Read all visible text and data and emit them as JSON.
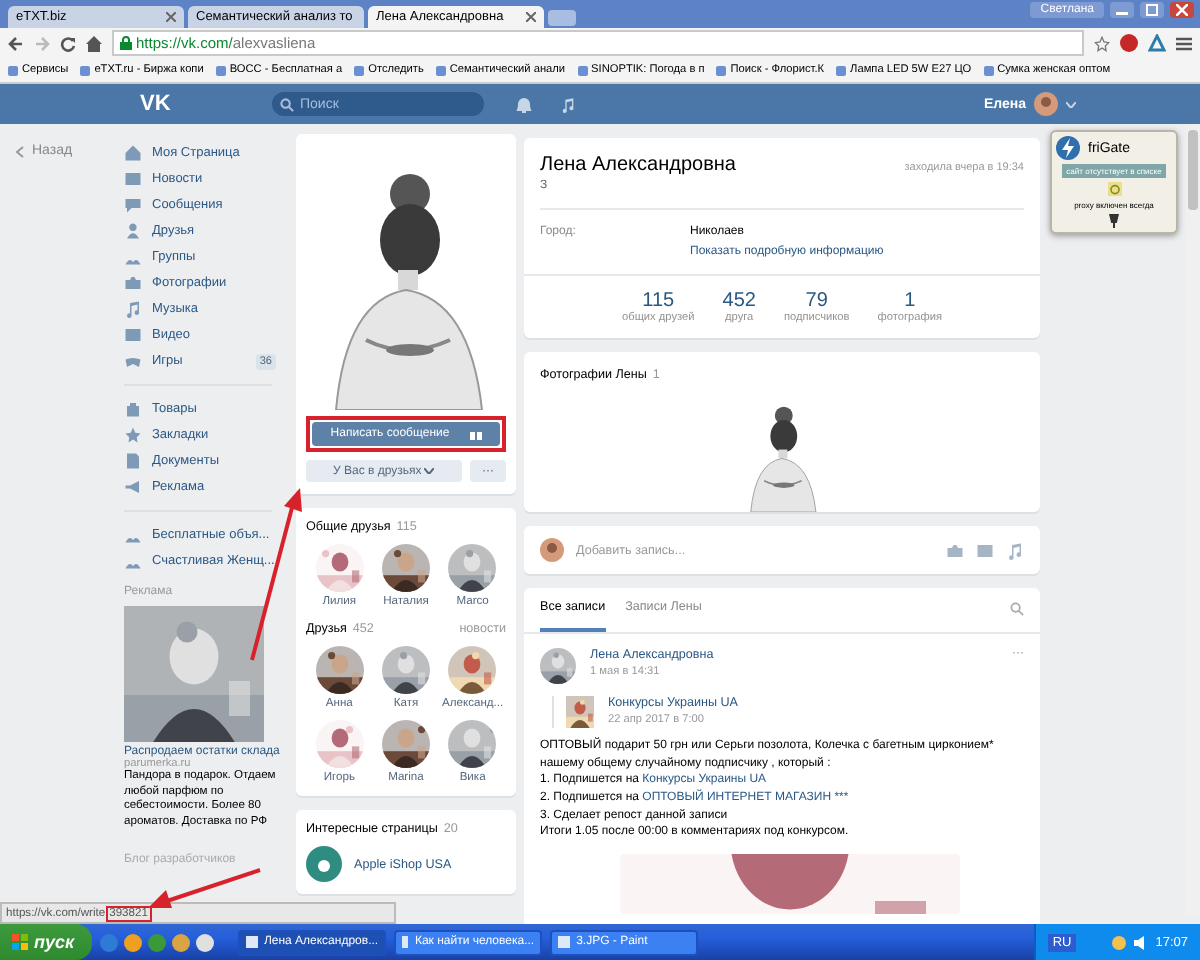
{
  "browser": {
    "tabs": [
      {
        "title": "eTXT.biz",
        "selected": false
      },
      {
        "title": "Семантический анализ то",
        "selected": false
      },
      {
        "title": "Лена Александровна",
        "selected": true
      }
    ],
    "profile_name": "Светлана",
    "address_host": "https://vk.com/",
    "address_path": "alexvasliena",
    "bookmarks": [
      "Сервисы",
      "eTXT.ru - Биржа копи",
      "ВОСС - Бесплатная а",
      "Отследить",
      "Семантический анали",
      "SINOPTIK: Погода в п",
      "Поиск - Флорист.К",
      "Лампа LED 5W E27 ЦО",
      "Сумка женская оптом"
    ]
  },
  "header": {
    "logo": "VK",
    "search": {
      "placeholder": "Поиск"
    },
    "user_name": "Елена"
  },
  "sidebar": {
    "back": "Назад",
    "groups": [
      {
        "items": [
          {
            "label": "Моя Страница"
          },
          {
            "label": "Новости"
          },
          {
            "label": "Сообщения"
          },
          {
            "label": "Друзья"
          },
          {
            "label": "Группы"
          },
          {
            "label": "Фотографии"
          },
          {
            "label": "Музыка"
          },
          {
            "label": "Видео"
          },
          {
            "label": "Игры",
            "count": "36"
          }
        ]
      },
      {
        "items": [
          {
            "label": "Товары"
          },
          {
            "label": "Закладки"
          },
          {
            "label": "Документы"
          },
          {
            "label": "Реклама"
          }
        ]
      },
      {
        "items": [
          {
            "label": "Бесплатные объя..."
          },
          {
            "label": "Счастливая Женщ..."
          }
        ]
      }
    ],
    "ad": {
      "heading": "Реклама",
      "title": "Распродаем остатки склада",
      "domain": "parumerka.ru",
      "text": "Пандора в подарок. Отдаем любой парфюм по себестоимости. Более 80 ароматов. Доставка по РФ"
    },
    "footer": "Блог разработчиков"
  },
  "profile_card": {
    "message_button": "Написать сообщение",
    "friend_button": "У Вас в друзьях",
    "more_button": "···"
  },
  "common_friends": {
    "title": "Общие друзья",
    "count": "115",
    "people": [
      {
        "name": "Лилия"
      },
      {
        "name": "Наталия"
      },
      {
        "name": "Marco"
      }
    ]
  },
  "friends": {
    "title": "Друзья",
    "count": "452",
    "link": "новости",
    "people": [
      {
        "name": "Анна"
      },
      {
        "name": "Катя"
      },
      {
        "name": "Александ..."
      },
      {
        "name": "Игорь"
      },
      {
        "name": "Marina"
      },
      {
        "name": "Вика"
      }
    ]
  },
  "pages": {
    "title": "Интересные страницы",
    "count": "20",
    "items": [
      {
        "name": "Apple iShop USA"
      }
    ]
  },
  "profile": {
    "name": "Лена Александровна",
    "status": "З",
    "last_seen": "заходила вчера в 19:34",
    "info": [
      {
        "label": "Город:",
        "value": "Николаев"
      }
    ],
    "more_link": "Показать подробную информацию",
    "counters": [
      {
        "value": "115",
        "label": "общих друзей"
      },
      {
        "value": "452",
        "label": "друга"
      },
      {
        "value": "79",
        "label": "подписчиков"
      },
      {
        "value": "1",
        "label": "фотография"
      }
    ]
  },
  "photos": {
    "title": "Фотографии Лены",
    "count": "1"
  },
  "composer": {
    "placeholder": "Добавить запись..."
  },
  "wall": {
    "tabs": [
      {
        "label": "Все записи",
        "selected": true
      },
      {
        "label": "Записи Лены",
        "selected": false
      }
    ],
    "post": {
      "author": "Лена Александровна",
      "date": "1 мая в 14:31",
      "menu": "···",
      "repost": {
        "author": "Конкурсы Украины UA",
        "date": "22 апр 2017 в 7:00"
      },
      "lines": [
        {
          "text": "ОПТОВЫЙ подарит 50 грн или Серьги позолота, Колечка с багетным цирконием* нашему общему случайному подписчику , который :"
        },
        {
          "text": "1. Подпишется на ",
          "link": "Конкурсы Украины UA"
        },
        {
          "text": "2. Подпишется на ",
          "link": "ОПТОВЫЙ ИНТЕРНЕТ МАГАЗИН ***"
        },
        {
          "text": "3. Сделает репост данной записи"
        },
        {
          "text": "Итоги 1.05 после 00:00 в комментариях под конкурсом."
        }
      ]
    }
  },
  "frigate": {
    "title": "friGate",
    "status": "сайт отсутствует в списке",
    "mode": "proxy включен всегда"
  },
  "status_bar": {
    "url": "https://vk.com/write",
    "highlight": "393821"
  },
  "taskbar": {
    "start": "пуск",
    "tasks": [
      {
        "title": "Лена Александров...",
        "selected": true
      },
      {
        "title": "Как найти человека...",
        "selected": false
      },
      {
        "title": "3.JPG - Paint",
        "selected": false
      }
    ],
    "language": "RU",
    "time": "17:07"
  }
}
